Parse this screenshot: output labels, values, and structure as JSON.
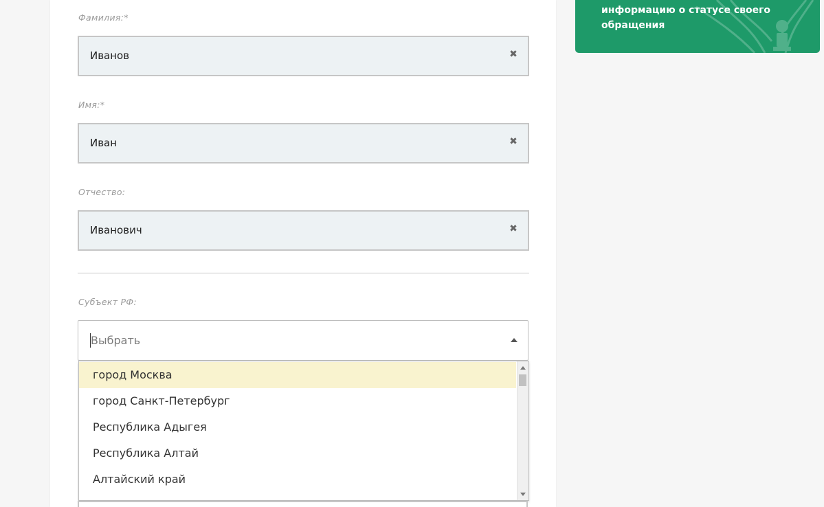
{
  "form": {
    "last_name": {
      "label": "Фамилия:*",
      "value": "Иванов"
    },
    "first_name": {
      "label": "Имя:*",
      "value": "Иван"
    },
    "middle_name": {
      "label": "Отчество:",
      "value": "Иванович"
    },
    "region": {
      "label": "Субъект РФ:",
      "placeholder": "Выбрать",
      "options": [
        "город Москва",
        "город Санкт-Петербург",
        "Республика Адыгея",
        "Республика Алтай",
        "Алтайский край"
      ],
      "highlighted_option": "город Москва"
    }
  },
  "banner": {
    "text": "информацию о статусе своего обращения",
    "color": "#1e9a69"
  }
}
